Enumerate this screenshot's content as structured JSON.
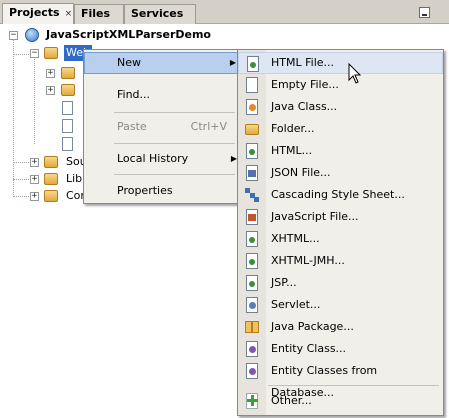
{
  "tabs": [
    {
      "label": "Projects",
      "close": "×",
      "active": true
    },
    {
      "label": "Files",
      "active": false
    },
    {
      "label": "Services",
      "active": false
    }
  ],
  "tree": {
    "project_name": "JavaScriptXMLParserDemo",
    "selected_node": "Web",
    "collapsed_toggle": "+",
    "expanded_toggle": "−",
    "children": [
      {
        "label": "Sou"
      },
      {
        "label": "Libr"
      },
      {
        "label": "Con"
      }
    ]
  },
  "context_menu": {
    "items": [
      {
        "label": "New",
        "has_submenu": true,
        "hover": true
      },
      {
        "label": "Find..."
      },
      {
        "label": "Paste",
        "shortcut": "Ctrl+V",
        "disabled": true
      },
      {
        "label": "Local History",
        "has_submenu": true
      },
      {
        "label": "Properties"
      }
    ],
    "submenu_arrow": "▶"
  },
  "new_submenu": {
    "items": [
      {
        "label": "HTML File...",
        "icon": "html-file-icon"
      },
      {
        "label": "Empty File...",
        "icon": "empty-file-icon"
      },
      {
        "label": "Java Class...",
        "icon": "java-class-icon"
      },
      {
        "label": "Folder...",
        "icon": "folder-icon"
      },
      {
        "label": "HTML...",
        "icon": "html-icon"
      },
      {
        "label": "JSON File...",
        "icon": "json-file-icon"
      },
      {
        "label": "Cascading Style Sheet...",
        "icon": "css-icon"
      },
      {
        "label": "JavaScript File...",
        "icon": "javascript-file-icon"
      },
      {
        "label": "XHTML...",
        "icon": "xhtml-icon"
      },
      {
        "label": "XHTML-JMH...",
        "icon": "xhtml-icon"
      },
      {
        "label": "JSP...",
        "icon": "jsp-icon"
      },
      {
        "label": "Servlet...",
        "icon": "servlet-icon"
      },
      {
        "label": "Java Package...",
        "icon": "java-package-icon"
      },
      {
        "label": "Entity Class...",
        "icon": "entity-class-icon"
      },
      {
        "label": "Entity Classes from Database...",
        "icon": "entity-classes-db-icon"
      },
      {
        "label": "Other...",
        "icon": "other-plus-icon"
      }
    ]
  },
  "colors": {
    "selection": "#3169c6",
    "menu_hover": "#b9cfee",
    "menu_background": "#f1efea",
    "tab_bar": "#d4d0c8"
  }
}
